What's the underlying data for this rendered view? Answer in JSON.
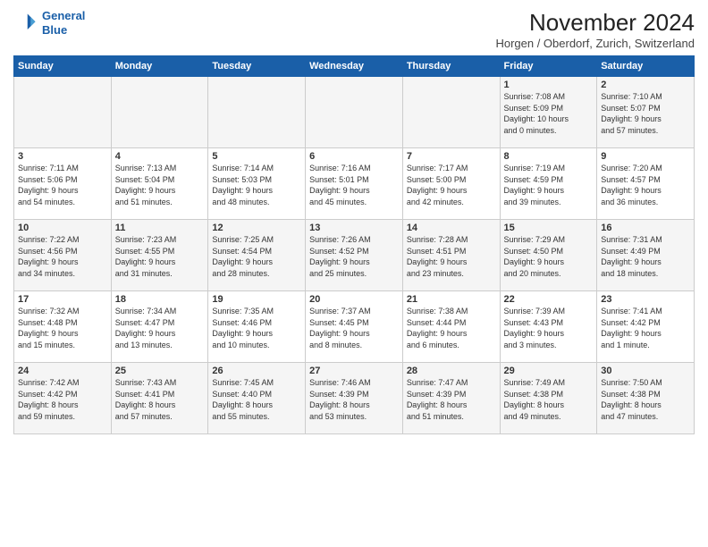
{
  "logo": {
    "line1": "General",
    "line2": "Blue"
  },
  "title": "November 2024",
  "subtitle": "Horgen / Oberdorf, Zurich, Switzerland",
  "weekdays": [
    "Sunday",
    "Monday",
    "Tuesday",
    "Wednesday",
    "Thursday",
    "Friday",
    "Saturday"
  ],
  "weeks": [
    [
      {
        "day": "",
        "info": ""
      },
      {
        "day": "",
        "info": ""
      },
      {
        "day": "",
        "info": ""
      },
      {
        "day": "",
        "info": ""
      },
      {
        "day": "",
        "info": ""
      },
      {
        "day": "1",
        "info": "Sunrise: 7:08 AM\nSunset: 5:09 PM\nDaylight: 10 hours\nand 0 minutes."
      },
      {
        "day": "2",
        "info": "Sunrise: 7:10 AM\nSunset: 5:07 PM\nDaylight: 9 hours\nand 57 minutes."
      }
    ],
    [
      {
        "day": "3",
        "info": "Sunrise: 7:11 AM\nSunset: 5:06 PM\nDaylight: 9 hours\nand 54 minutes."
      },
      {
        "day": "4",
        "info": "Sunrise: 7:13 AM\nSunset: 5:04 PM\nDaylight: 9 hours\nand 51 minutes."
      },
      {
        "day": "5",
        "info": "Sunrise: 7:14 AM\nSunset: 5:03 PM\nDaylight: 9 hours\nand 48 minutes."
      },
      {
        "day": "6",
        "info": "Sunrise: 7:16 AM\nSunset: 5:01 PM\nDaylight: 9 hours\nand 45 minutes."
      },
      {
        "day": "7",
        "info": "Sunrise: 7:17 AM\nSunset: 5:00 PM\nDaylight: 9 hours\nand 42 minutes."
      },
      {
        "day": "8",
        "info": "Sunrise: 7:19 AM\nSunset: 4:59 PM\nDaylight: 9 hours\nand 39 minutes."
      },
      {
        "day": "9",
        "info": "Sunrise: 7:20 AM\nSunset: 4:57 PM\nDaylight: 9 hours\nand 36 minutes."
      }
    ],
    [
      {
        "day": "10",
        "info": "Sunrise: 7:22 AM\nSunset: 4:56 PM\nDaylight: 9 hours\nand 34 minutes."
      },
      {
        "day": "11",
        "info": "Sunrise: 7:23 AM\nSunset: 4:55 PM\nDaylight: 9 hours\nand 31 minutes."
      },
      {
        "day": "12",
        "info": "Sunrise: 7:25 AM\nSunset: 4:54 PM\nDaylight: 9 hours\nand 28 minutes."
      },
      {
        "day": "13",
        "info": "Sunrise: 7:26 AM\nSunset: 4:52 PM\nDaylight: 9 hours\nand 25 minutes."
      },
      {
        "day": "14",
        "info": "Sunrise: 7:28 AM\nSunset: 4:51 PM\nDaylight: 9 hours\nand 23 minutes."
      },
      {
        "day": "15",
        "info": "Sunrise: 7:29 AM\nSunset: 4:50 PM\nDaylight: 9 hours\nand 20 minutes."
      },
      {
        "day": "16",
        "info": "Sunrise: 7:31 AM\nSunset: 4:49 PM\nDaylight: 9 hours\nand 18 minutes."
      }
    ],
    [
      {
        "day": "17",
        "info": "Sunrise: 7:32 AM\nSunset: 4:48 PM\nDaylight: 9 hours\nand 15 minutes."
      },
      {
        "day": "18",
        "info": "Sunrise: 7:34 AM\nSunset: 4:47 PM\nDaylight: 9 hours\nand 13 minutes."
      },
      {
        "day": "19",
        "info": "Sunrise: 7:35 AM\nSunset: 4:46 PM\nDaylight: 9 hours\nand 10 minutes."
      },
      {
        "day": "20",
        "info": "Sunrise: 7:37 AM\nSunset: 4:45 PM\nDaylight: 9 hours\nand 8 minutes."
      },
      {
        "day": "21",
        "info": "Sunrise: 7:38 AM\nSunset: 4:44 PM\nDaylight: 9 hours\nand 6 minutes."
      },
      {
        "day": "22",
        "info": "Sunrise: 7:39 AM\nSunset: 4:43 PM\nDaylight: 9 hours\nand 3 minutes."
      },
      {
        "day": "23",
        "info": "Sunrise: 7:41 AM\nSunset: 4:42 PM\nDaylight: 9 hours\nand 1 minute."
      }
    ],
    [
      {
        "day": "24",
        "info": "Sunrise: 7:42 AM\nSunset: 4:42 PM\nDaylight: 8 hours\nand 59 minutes."
      },
      {
        "day": "25",
        "info": "Sunrise: 7:43 AM\nSunset: 4:41 PM\nDaylight: 8 hours\nand 57 minutes."
      },
      {
        "day": "26",
        "info": "Sunrise: 7:45 AM\nSunset: 4:40 PM\nDaylight: 8 hours\nand 55 minutes."
      },
      {
        "day": "27",
        "info": "Sunrise: 7:46 AM\nSunset: 4:39 PM\nDaylight: 8 hours\nand 53 minutes."
      },
      {
        "day": "28",
        "info": "Sunrise: 7:47 AM\nSunset: 4:39 PM\nDaylight: 8 hours\nand 51 minutes."
      },
      {
        "day": "29",
        "info": "Sunrise: 7:49 AM\nSunset: 4:38 PM\nDaylight: 8 hours\nand 49 minutes."
      },
      {
        "day": "30",
        "info": "Sunrise: 7:50 AM\nSunset: 4:38 PM\nDaylight: 8 hours\nand 47 minutes."
      }
    ]
  ]
}
